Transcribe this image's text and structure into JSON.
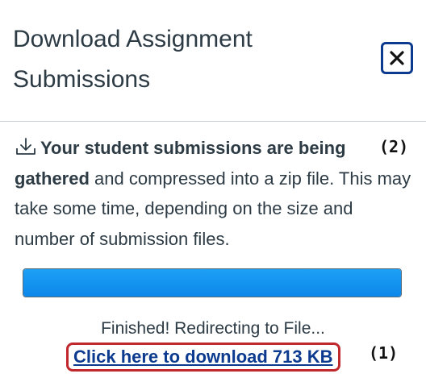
{
  "dialog": {
    "title": "Download Assignment Submissions",
    "close_label": "×"
  },
  "message": {
    "bold_part": "Your student submissions are being gathered",
    "rest": " and compressed into a zip file. This may take some time, depending on the size and number of submission files."
  },
  "progress": {
    "percent": 100
  },
  "status_text": "Finished! Redirecting to File...",
  "download_link": {
    "label": "Click here to download 713 KB"
  },
  "annotations": {
    "one": "(1)",
    "two": "(2)"
  },
  "colors": {
    "progress_fill": "#1ea0f5",
    "link": "#0b3a8f",
    "highlight_border": "#c0282d",
    "close_border": "#0b3a8f"
  },
  "icons": {
    "close": "close-icon",
    "download": "download-icon"
  }
}
